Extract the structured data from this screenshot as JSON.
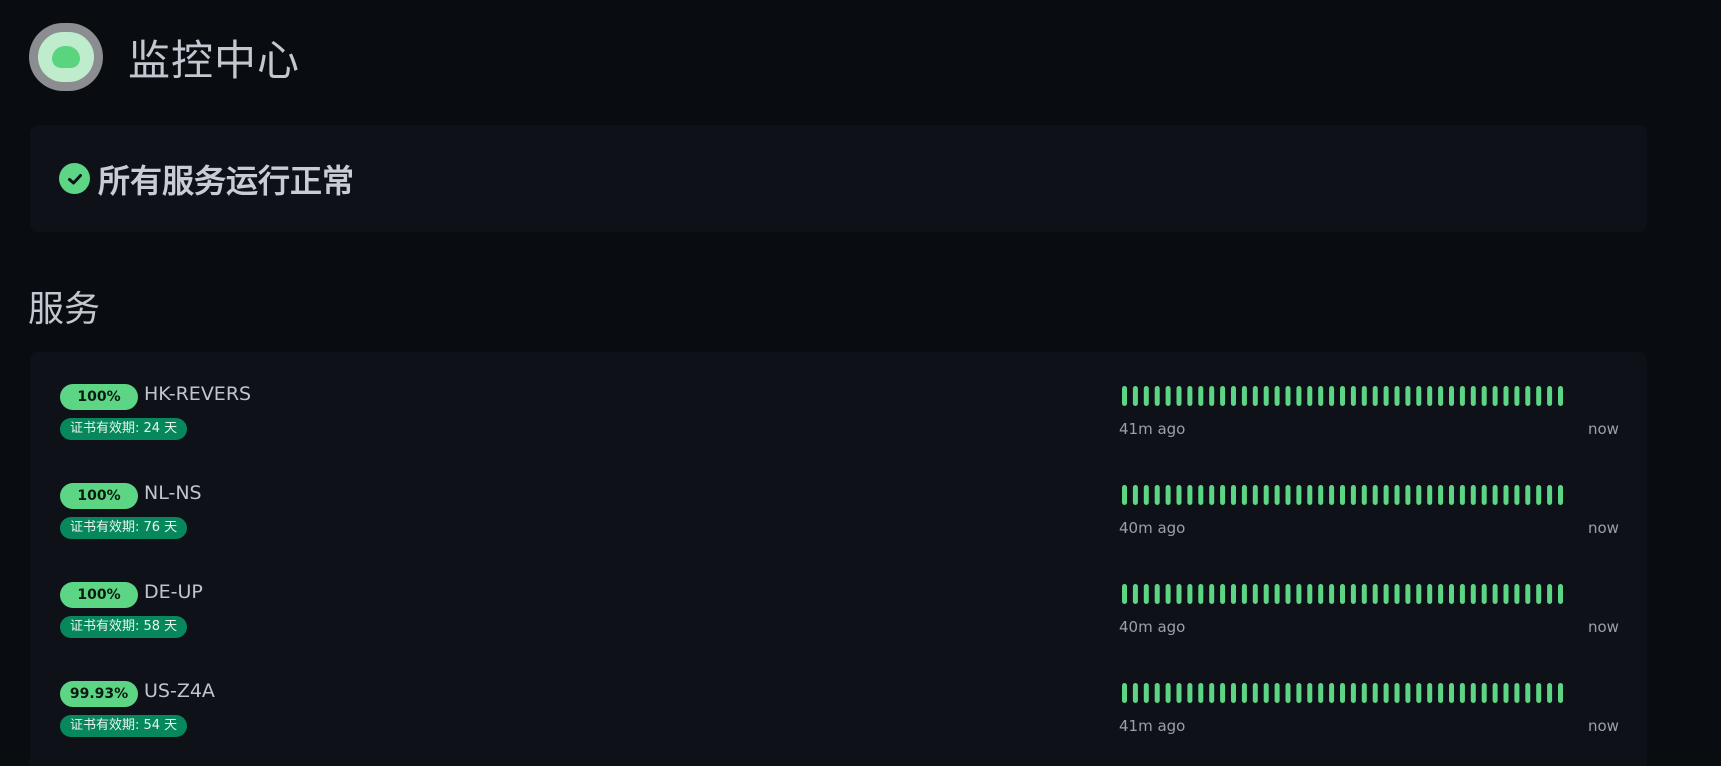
{
  "header": {
    "title": "监控中心"
  },
  "status": {
    "text": "所有服务运行正常",
    "color": "#5cd684"
  },
  "section": {
    "title": "服务"
  },
  "colors": {
    "accent": "#5cd684",
    "cert_badge": "#07875c",
    "background": "#090c10",
    "card": "#0e1218"
  },
  "services": [
    {
      "uptime": "100%",
      "name": "HK-REVERS",
      "cert": "证书有效期: 24 天",
      "start_label": "41m ago",
      "end_label": "now",
      "beats_up": 41,
      "beats_total": 41
    },
    {
      "uptime": "100%",
      "name": "NL-NS",
      "cert": "证书有效期: 76 天",
      "start_label": "40m ago",
      "end_label": "now",
      "beats_up": 41,
      "beats_total": 41
    },
    {
      "uptime": "100%",
      "name": "DE-UP",
      "cert": "证书有效期: 58 天",
      "start_label": "40m ago",
      "end_label": "now",
      "beats_up": 41,
      "beats_total": 41
    },
    {
      "uptime": "99.93%",
      "name": "US-Z4A",
      "cert": "证书有效期: 54 天",
      "start_label": "41m ago",
      "end_label": "now",
      "beats_up": 41,
      "beats_total": 41
    }
  ]
}
